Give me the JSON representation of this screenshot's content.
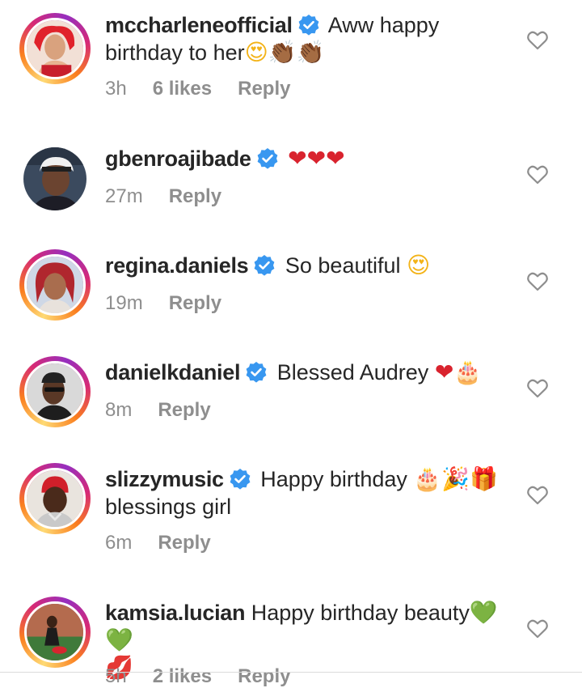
{
  "colors": {
    "ring": "#d62976",
    "verified": "#3897f0",
    "meta": "#8e8e8e",
    "text": "#262626"
  },
  "comments": [
    {
      "username": "mccharleneofficial",
      "verified": true,
      "text": "Aww happy birthday to her",
      "emojis": [
        "😍",
        "👏🏾",
        "👏🏾"
      ],
      "time": "3h",
      "likes": "6 likes",
      "reply": "Reply",
      "ring": true
    },
    {
      "username": "gbenroajibade",
      "verified": true,
      "text": "",
      "emojis": [
        "❤",
        "❤",
        "❤"
      ],
      "time": "27m",
      "likes": "",
      "reply": "Reply",
      "ring": false
    },
    {
      "username": "regina.daniels",
      "verified": true,
      "text": "So beautiful",
      "emojis": [
        "😍"
      ],
      "time": "19m",
      "likes": "",
      "reply": "Reply",
      "ring": true
    },
    {
      "username": "danielkdaniel",
      "verified": true,
      "text": "Blessed Audrey",
      "emojis": [
        "❤",
        "🎂"
      ],
      "time": "8m",
      "likes": "",
      "reply": "Reply",
      "ring": true
    },
    {
      "username": "slizzymusic",
      "verified": true,
      "text": "Happy birthday",
      "text2": "blessings girl",
      "emojis": [
        "🎂",
        "🎉",
        "🎁"
      ],
      "time": "6m",
      "likes": "",
      "reply": "Reply",
      "ring": true
    },
    {
      "username": "kamsia.lucian",
      "verified": false,
      "text": "Happy birthday beauty",
      "emojis": [
        "💚",
        "💚",
        "💋"
      ],
      "time": "5h",
      "likes": "2 likes",
      "reply": "Reply",
      "ring": true
    }
  ]
}
